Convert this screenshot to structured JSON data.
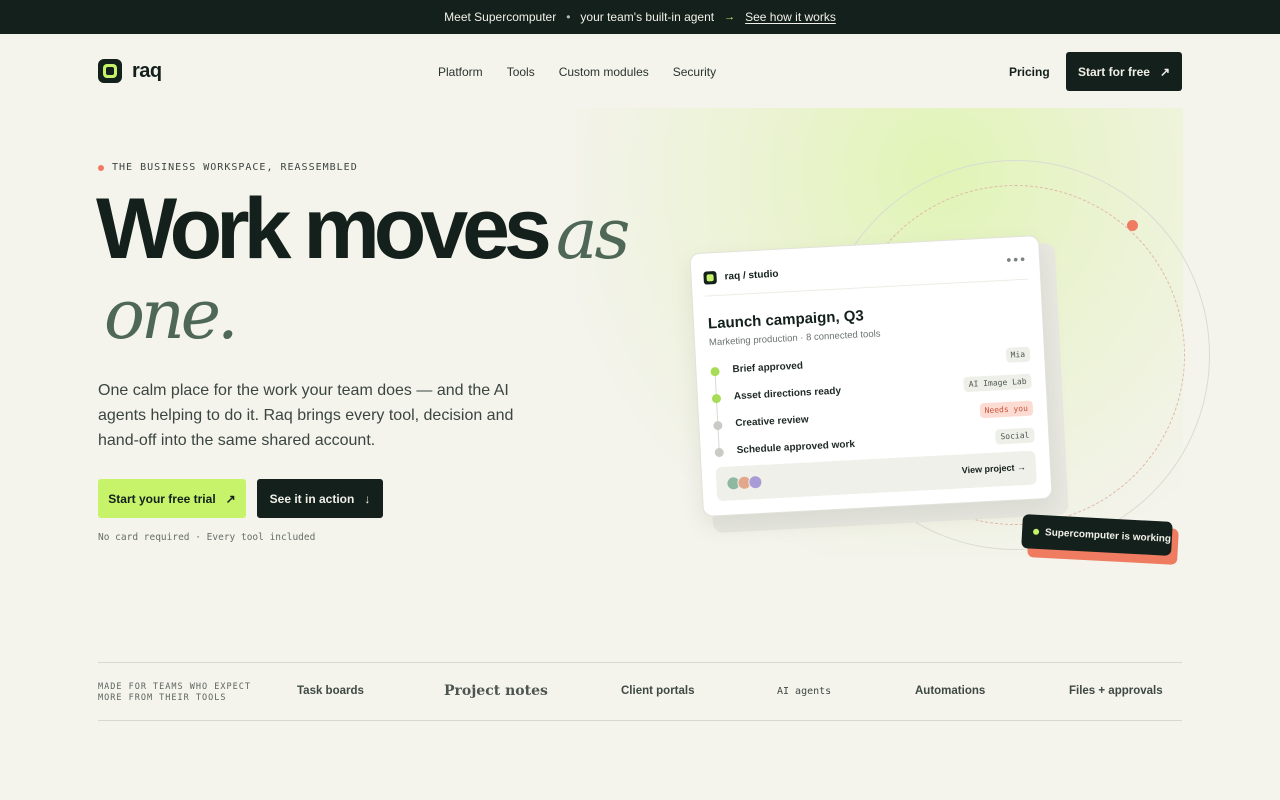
{
  "announcement": {
    "lead": "Meet Supercomputer",
    "separator": "•",
    "middle": "your team's built-in agent",
    "arrow": "→",
    "link": "See how it works"
  },
  "nav": {
    "brand": "raq",
    "items": [
      "Platform",
      "Tools",
      "Custom modules",
      "Security"
    ],
    "pricing": "Pricing",
    "cta": "Start for free",
    "cta_icon": "↗"
  },
  "hero": {
    "eyebrow": "THE BUSINESS WORKSPACE, REASSEMBLED",
    "headline_main": "Work moves",
    "headline_italic": "as",
    "headline_line2": "one.",
    "subtext": "One calm place for the work your team does — and the AI agents helping to do it. Raq brings every tool, decision and hand-off into the same shared account.",
    "primary_cta": "Start your free trial",
    "primary_icon": "↗",
    "secondary_cta": "See it in action",
    "secondary_icon": "↓",
    "fine_print": "No card required · Every tool included"
  },
  "card": {
    "workspace": "raq / studio",
    "menu": "•••",
    "title": "Launch campaign, Q3",
    "subtitle": "Marketing production · 8 connected tools",
    "tasks": [
      {
        "label": "Brief approved",
        "tag": "Mia",
        "status": "done"
      },
      {
        "label": "Asset directions ready",
        "tag": "AI Image Lab",
        "status": "done"
      },
      {
        "label": "Creative review",
        "tag": "Needs you",
        "status": "pending"
      },
      {
        "label": "Schedule approved work",
        "tag": "Social",
        "status": "pending"
      }
    ],
    "avatar_colors": [
      "#8fb8a2",
      "#e3a88b",
      "#a89bd6"
    ],
    "footer_link": "View project →"
  },
  "agent_badge": "Supercomputer is working",
  "logos": {
    "label": "MADE FOR TEAMS WHO EXPECT MORE FROM THEIR TOOLS",
    "items": [
      "Task boards",
      "Project notes",
      "Client portals",
      "AI agents",
      "Automations",
      "Files + approvals"
    ]
  },
  "colors": {
    "ink": "#13201b",
    "lime": "#c6f36a",
    "coral": "#ef7b61",
    "sage": "#4e6756",
    "paper": "#f4f3ec"
  }
}
